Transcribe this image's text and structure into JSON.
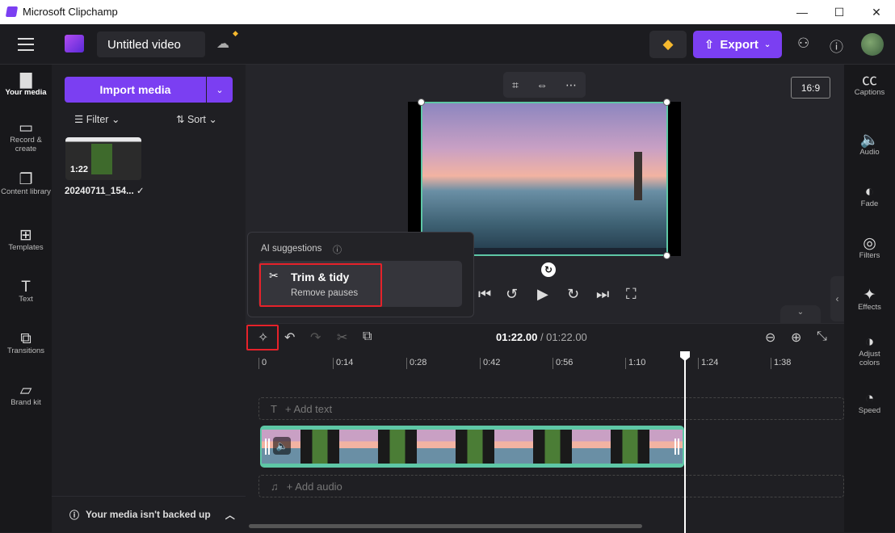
{
  "window": {
    "title": "Microsoft Clipchamp",
    "minimize": "—",
    "maximize": "☐",
    "close": "✕"
  },
  "header": {
    "project_title": "Untitled video",
    "export_label": "Export"
  },
  "left_nav": [
    {
      "label": "Your media"
    },
    {
      "label": "Record & create"
    },
    {
      "label": "Content library"
    },
    {
      "label": "Templates"
    },
    {
      "label": "Text"
    },
    {
      "label": "Transitions"
    },
    {
      "label": "Brand kit"
    }
  ],
  "media": {
    "import_label": "Import media",
    "filter_label": "Filter",
    "sort_label": "Sort",
    "file_name": "20240711_154...",
    "file_duration": "1:22",
    "backup_notice": "Your media isn't backed up"
  },
  "preview": {
    "aspect_ratio": "16:9"
  },
  "ai_suggestions": {
    "title": "AI suggestions",
    "card_title": "Trim & tidy",
    "card_subtitle": "Remove pauses"
  },
  "timeline": {
    "current_time": "01:22.00",
    "total_time": "/ 01:22.00",
    "ruler": [
      "0",
      "0:14",
      "0:28",
      "0:42",
      "0:56",
      "1:10",
      "1:24",
      "1:38"
    ],
    "add_text": "+ Add text",
    "add_audio": "+ Add audio"
  },
  "right_nav": [
    {
      "label": "Captions"
    },
    {
      "label": "Audio"
    },
    {
      "label": "Fade"
    },
    {
      "label": "Filters"
    },
    {
      "label": "Effects"
    },
    {
      "label": "Adjust colors"
    },
    {
      "label": "Speed"
    }
  ],
  "colors": {
    "accent": "#7b3ff2",
    "highlight": "#e5222a",
    "clip_border": "#5ec7a6"
  }
}
